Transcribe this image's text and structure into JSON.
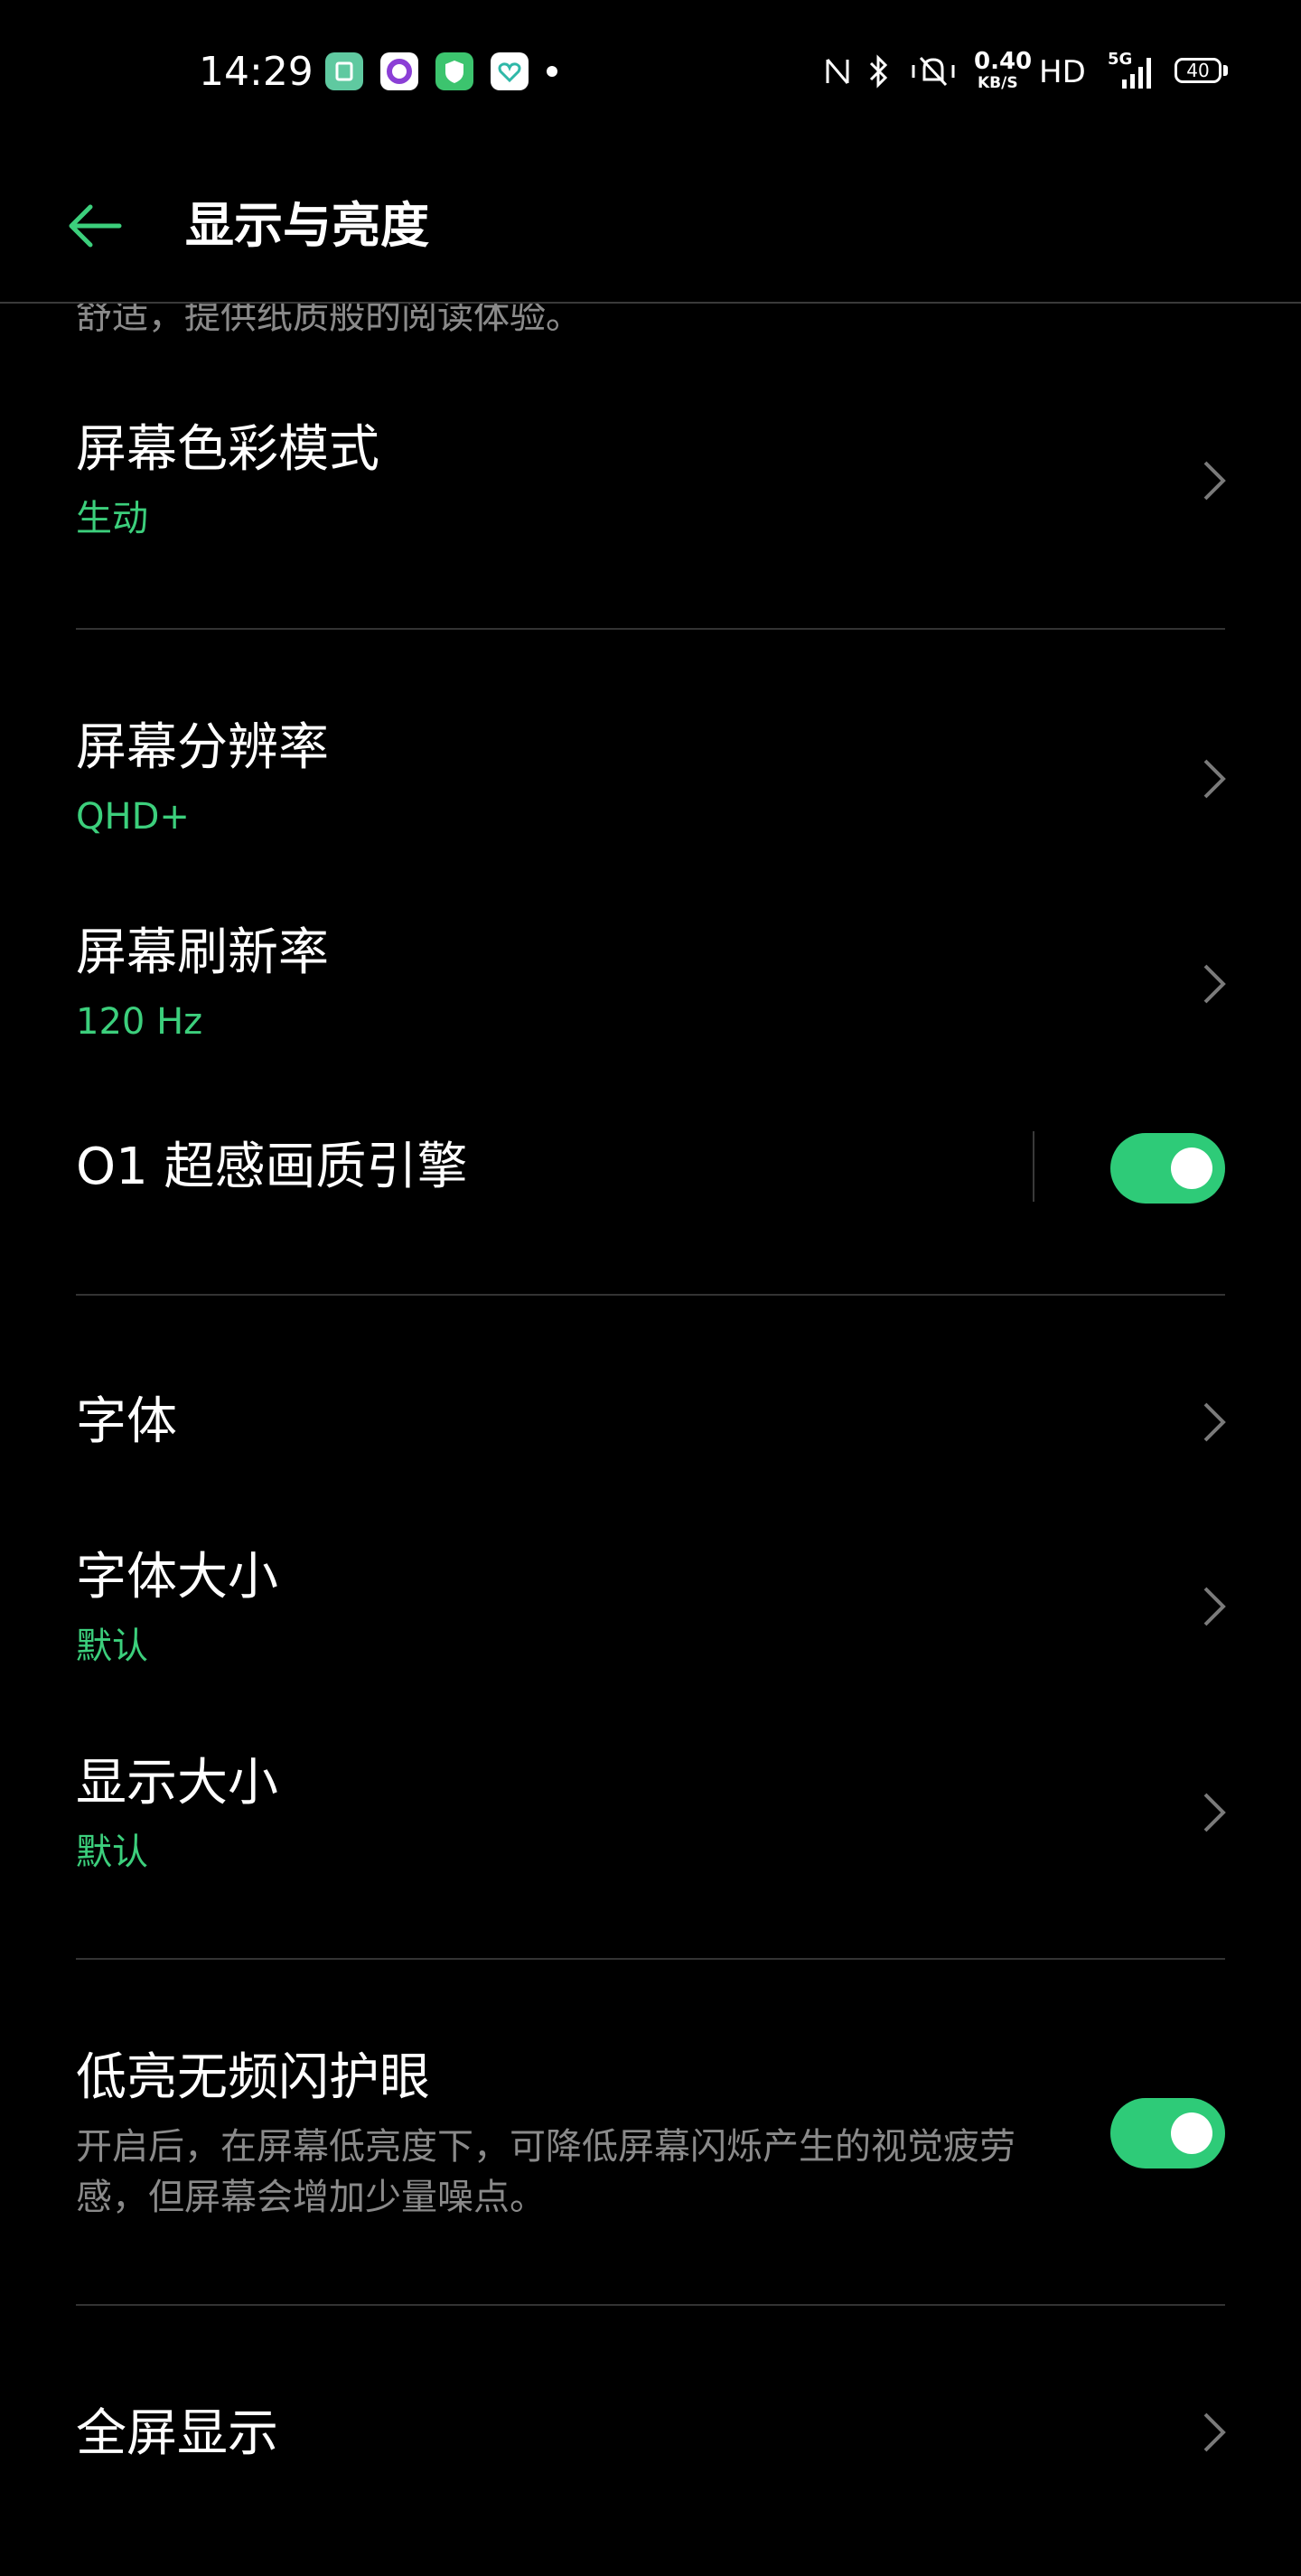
{
  "colors": {
    "background": "#000000",
    "accent": "#3ccf7c",
    "toggle_on": "#2ecb78",
    "secondary_text": "#8a8a8a",
    "divider": "#333333"
  },
  "status_bar": {
    "time": "14:29",
    "app_icons": [
      "app-icon-green",
      "app-icon-purple-ring",
      "app-icon-shield",
      "app-icon-heart"
    ],
    "net_speed_value": "0.40",
    "net_speed_unit": "KB/S",
    "hd_label": "HD",
    "network_label": "5G",
    "battery_level": "40",
    "icons": [
      "nfc-icon",
      "bluetooth-icon",
      "vibrate-silent-icon",
      "signal-icon",
      "battery-icon"
    ]
  },
  "header": {
    "title": "显示与亮度",
    "back_icon": "back-arrow-icon"
  },
  "scrolled_text": "舒适，提供纸质般的阅读体验。",
  "settings": {
    "color_mode": {
      "title": "屏幕色彩模式",
      "value": "生动"
    },
    "resolution": {
      "title": "屏幕分辨率",
      "value": "QHD+"
    },
    "refresh_rate": {
      "title": "屏幕刷新率",
      "value": "120 Hz"
    },
    "o1_engine": {
      "title": "O1 超感画质引擎",
      "enabled": true
    },
    "font": {
      "title": "字体"
    },
    "font_size": {
      "title": "字体大小",
      "value": "默认"
    },
    "display_size": {
      "title": "显示大小",
      "value": "默认"
    },
    "dc_dimming": {
      "title": "低亮无频闪护眼",
      "description": "开启后，在屏幕低亮度下，可降低屏幕闪烁产生的视觉疲劳感，但屏幕会增加少量噪点。",
      "enabled": true
    },
    "full_screen": {
      "title": "全屏显示"
    }
  }
}
